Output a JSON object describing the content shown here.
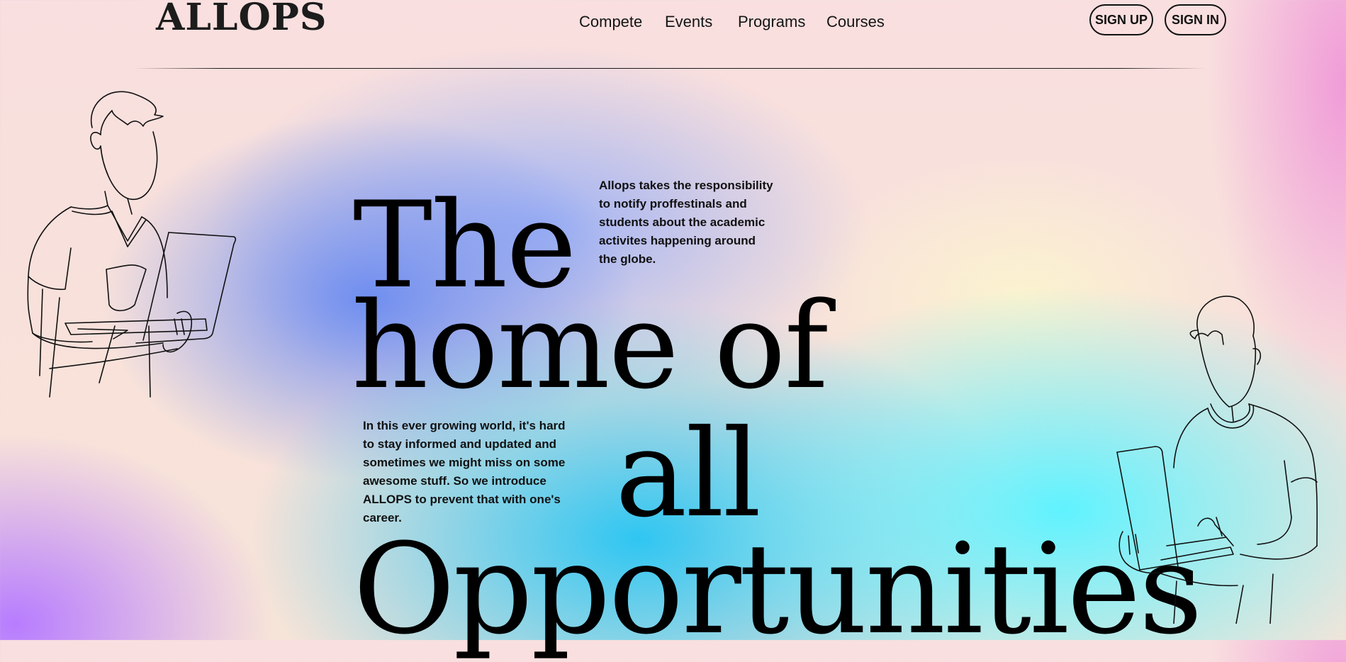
{
  "brand": {
    "logo": "ALLOPS"
  },
  "nav": {
    "items": [
      {
        "label": "Compete"
      },
      {
        "label": "Events"
      },
      {
        "label": "Programs"
      },
      {
        "label": "Courses"
      }
    ]
  },
  "auth": {
    "signup_label": "SIGN UP",
    "signin_label": "SIGN IN"
  },
  "hero": {
    "line1": "The",
    "line2": "home of",
    "line3": "all",
    "line4": "Opportunities"
  },
  "blurbs": {
    "top": "Allops takes the responsibility to notify proffestinals and students about the academic activites happening around the globe.",
    "bottom": "In this ever growing world, it's hard to stay informed and updated and sometimes we might miss on some awesome stuff. So we introduce ALLOPS to prevent that with one's career."
  },
  "illustrations": {
    "left": "man-with-laptop-illustration",
    "right": "man-with-laptop-illustration"
  },
  "colors": {
    "text": "#111111",
    "background_top": "#f9dfdf",
    "gradient_blue": "#2fc6f2",
    "gradient_cyan": "#5ff3ff",
    "gradient_purple": "#b77cff",
    "gradient_pink": "#f09bd8",
    "gradient_yellow": "#fbf3cf"
  }
}
